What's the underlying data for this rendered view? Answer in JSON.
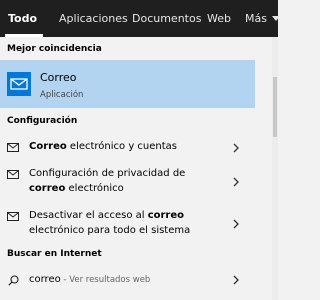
{
  "tabs": [
    {
      "label": "Todo",
      "active": true
    },
    {
      "label": "Aplicaciones"
    },
    {
      "label": "Documentos"
    },
    {
      "label": "Web"
    },
    {
      "label": "Más"
    }
  ],
  "best_match": {
    "header": "Mejor coincidencia",
    "title": "Correo",
    "subtitle": "Aplicación",
    "icon": "mail-app-icon"
  },
  "settings": {
    "header": "Configuración",
    "items": [
      {
        "pre": "",
        "bold": "Correo",
        "post": " electrónico y cuentas"
      },
      {
        "line1": "Configuración de privacidad de",
        "bold": "correo",
        "post": " electrónico"
      },
      {
        "pre": "Desactivar el acceso al ",
        "bold": "correo",
        "line2": "electrónico para todo el sistema"
      }
    ]
  },
  "web": {
    "header": "Buscar en Internet",
    "query": "correo",
    "suffix": " - Ver resultados web",
    "icon": "search-icon"
  },
  "colors": {
    "accent": "#0078d7",
    "selected_bg": "#b3d4f0",
    "tabbar_bg": "#1f1f1f"
  }
}
